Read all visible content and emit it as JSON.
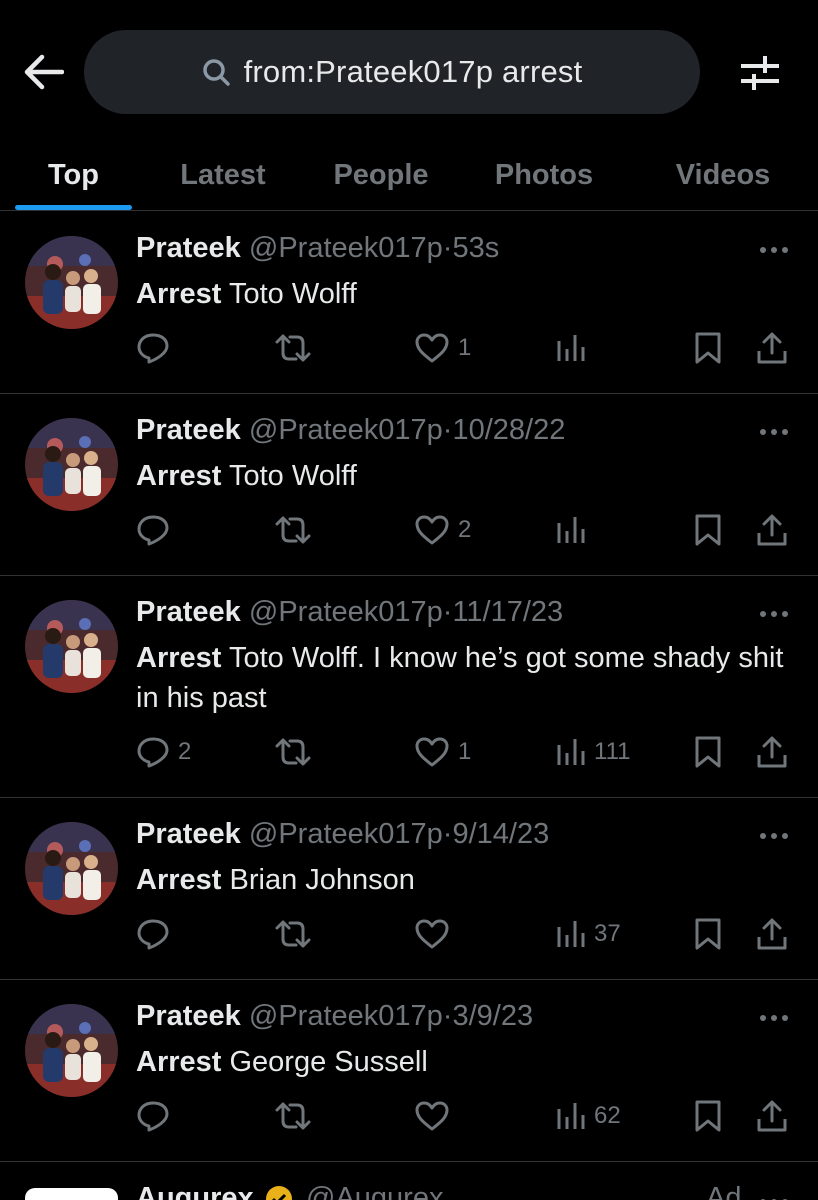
{
  "search": {
    "query": "from:Prateek017p arrest"
  },
  "tabs": [
    {
      "label": "Top",
      "active": true
    },
    {
      "label": "Latest",
      "active": false
    },
    {
      "label": "People",
      "active": false
    },
    {
      "label": "Photos",
      "active": false
    },
    {
      "label": "Videos",
      "active": false
    }
  ],
  "tweets": [
    {
      "name": "Prateek",
      "handle": "@Prateek017p",
      "sep": "·",
      "time": "53s",
      "bold": "Arrest",
      "rest": " Toto Wolff",
      "replies": "",
      "retweets": "",
      "likes": "1",
      "views": ""
    },
    {
      "name": "Prateek",
      "handle": "@Prateek017p",
      "sep": "·",
      "time": "10/28/22",
      "bold": "Arrest",
      "rest": " Toto Wolff",
      "replies": "",
      "retweets": "",
      "likes": "2",
      "views": ""
    },
    {
      "name": "Prateek",
      "handle": "@Prateek017p",
      "sep": "·",
      "time": "11/17/23",
      "bold": "Arrest",
      "rest": " Toto Wolff. I know he’s got some shady shit in his past",
      "replies": "2",
      "retweets": "",
      "likes": "1",
      "views": "111"
    },
    {
      "name": "Prateek",
      "handle": "@Prateek017p",
      "sep": "·",
      "time": "9/14/23",
      "bold": "Arrest",
      "rest": " Brian Johnson",
      "replies": "",
      "retweets": "",
      "likes": "",
      "views": "37"
    },
    {
      "name": "Prateek",
      "handle": "@Prateek017p",
      "sep": "·",
      "time": "3/9/23",
      "bold": "Arrest",
      "rest": " George Sussell",
      "replies": "",
      "retweets": "",
      "likes": "",
      "views": "62"
    }
  ],
  "ad": {
    "name": "Augurex",
    "handle": "@Augurex",
    "label": "Ad"
  },
  "colors": {
    "accent": "#1d9bf0",
    "background": "#000000",
    "muted": "#71767b",
    "text": "#e7e9ea"
  }
}
